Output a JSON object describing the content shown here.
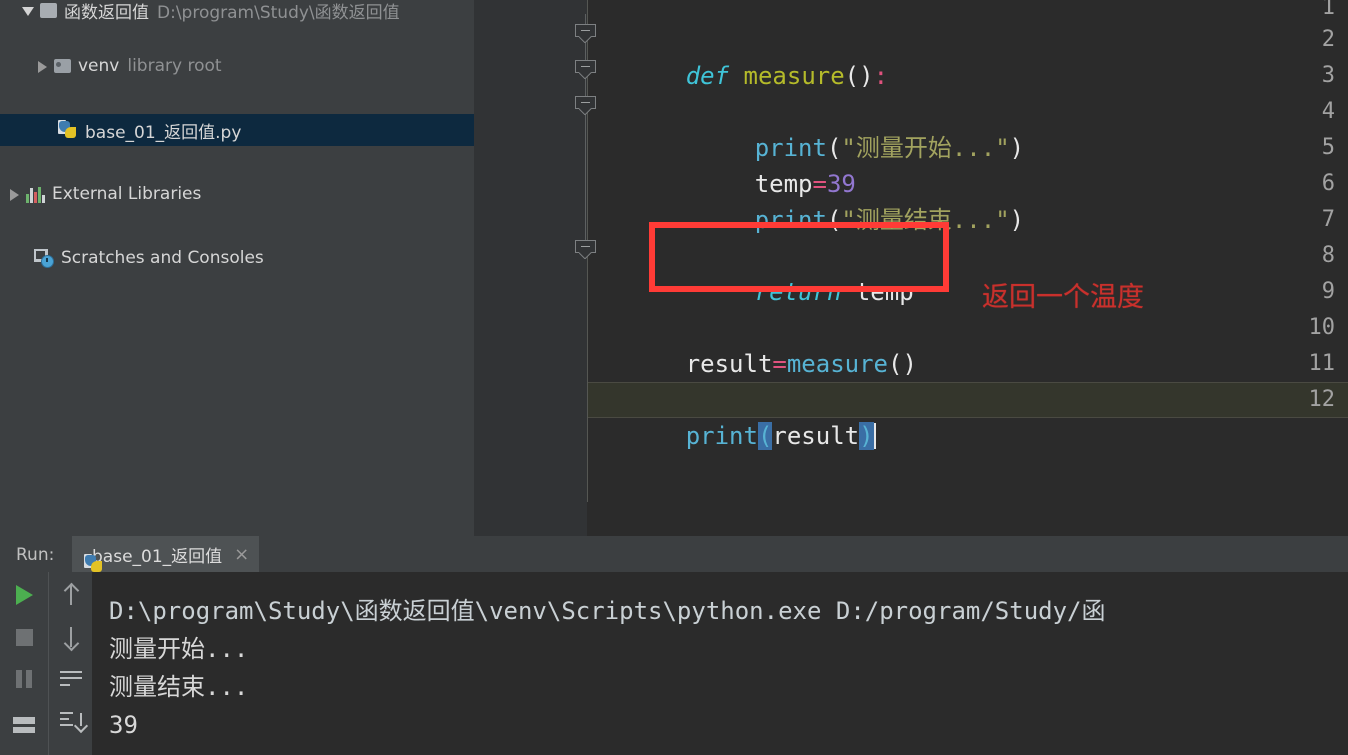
{
  "ide": {
    "theme_bg": "#2b2b2b",
    "panel_bg": "#3c3f41",
    "selection_bg": "#0d293f",
    "accent_red": "#ff3b36"
  },
  "sidebar": {
    "items": [
      {
        "label": "函数返回值",
        "detail": "D:\\program\\Study\\函数返回值",
        "icon": "folder-icon",
        "arrow": "chevron-down-icon",
        "selected": false
      },
      {
        "label": "venv",
        "detail": "library root",
        "icon": "folder-icon",
        "arrow": "chevron-right-icon",
        "selected": false
      },
      {
        "label": "base_01_返回值.py",
        "detail": "",
        "icon": "python-file-icon",
        "arrow": "",
        "selected": true
      },
      {
        "label": "External Libraries",
        "detail": "",
        "icon": "external-libraries-icon",
        "arrow": "chevron-right-icon",
        "selected": false
      },
      {
        "label": "Scratches and Consoles",
        "detail": "",
        "icon": "scratches-icon",
        "arrow": "",
        "selected": false
      }
    ]
  },
  "editor": {
    "line_numbers": [
      "1",
      "2",
      "3",
      "4",
      "5",
      "6",
      "7",
      "8",
      "9",
      "10",
      "11",
      "12"
    ],
    "current_line": 12,
    "lines": [
      {
        "n": 1,
        "text": ""
      },
      {
        "n": 2,
        "text": "def measure():"
      },
      {
        "n": 3,
        "text": ""
      },
      {
        "n": 4,
        "text": "    print(\"测量开始...\")"
      },
      {
        "n": 5,
        "text": "    temp=39"
      },
      {
        "n": 6,
        "text": "    print(\"测量结束...\")"
      },
      {
        "n": 7,
        "text": ""
      },
      {
        "n": 8,
        "text": "    return temp"
      },
      {
        "n": 9,
        "text": ""
      },
      {
        "n": 10,
        "text": "result=measure()"
      },
      {
        "n": 11,
        "text": ""
      },
      {
        "n": 12,
        "text": "print(result)"
      }
    ],
    "tokens": {
      "kw_def": "def",
      "fn_measure": "measure",
      "paren_open": "(",
      "paren_close": ")",
      "colon": ":",
      "fn_print": "print",
      "str_start": "\"测量开始...\"",
      "str_end": "\"测量结束...\"",
      "var_temp": "temp",
      "op_assign": "=",
      "num_39": "39",
      "kw_return": "return",
      "var_result": "result"
    }
  },
  "annotation": {
    "box_target_line": 8,
    "text": "返回一个温度",
    "color": "#c9302c"
  },
  "run_panel": {
    "label": "Run:",
    "tab_title": "base_01_返回值",
    "tab_close": "×",
    "toolbar": [
      {
        "name": "rerun-button",
        "icon": "play-icon"
      },
      {
        "name": "stop-button",
        "icon": "stop-icon"
      },
      {
        "name": "pause-button",
        "icon": "pause-icon"
      },
      {
        "name": "print-button",
        "icon": "console-icon"
      },
      {
        "name": "prev-occurrence-button",
        "icon": "arrow-up-icon"
      },
      {
        "name": "next-occurrence-button",
        "icon": "arrow-down-icon"
      },
      {
        "name": "soft-wrap-button",
        "icon": "soft-wrap-icon"
      },
      {
        "name": "scroll-to-end-button",
        "icon": "scroll-to-end-icon"
      }
    ],
    "output": [
      "D:\\program\\Study\\函数返回值\\venv\\Scripts\\python.exe D:/program/Study/函",
      "测量开始...",
      "测量结束...",
      "39"
    ]
  }
}
